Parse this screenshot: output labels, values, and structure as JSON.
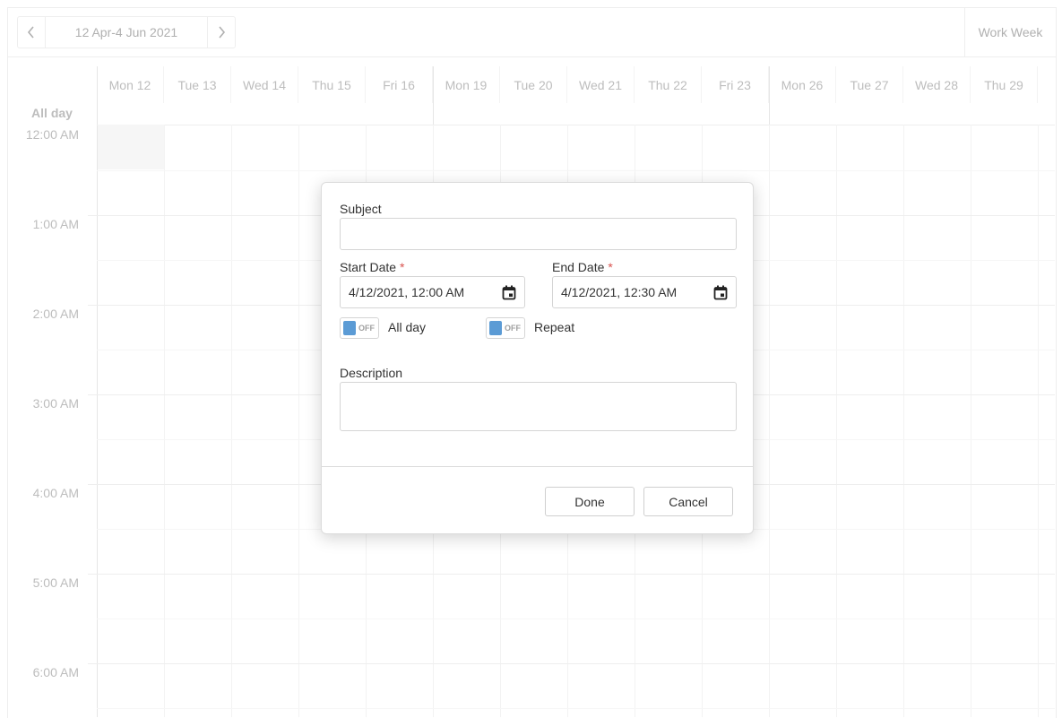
{
  "toolbar": {
    "date_range": "12 Apr-4 Jun 2021",
    "view": "Work Week"
  },
  "grid": {
    "days": [
      "Mon 12",
      "Tue 13",
      "Wed 14",
      "Thu 15",
      "Fri 16",
      "Mon 19",
      "Tue 20",
      "Wed 21",
      "Thu 22",
      "Fri 23",
      "Mon 26",
      "Tue 27",
      "Wed 28",
      "Thu 29"
    ],
    "allday_label": "All day",
    "times": [
      "12:00 AM",
      "1:00 AM",
      "2:00 AM",
      "3:00 AM",
      "4:00 AM",
      "5:00 AM",
      "6:00 AM"
    ]
  },
  "popup": {
    "subject_label": "Subject",
    "subject_value": "",
    "start_label": "Start Date",
    "start_value": "4/12/2021, 12:00 AM",
    "end_label": "End Date",
    "end_value": "4/12/2021, 12:30 AM",
    "required_mark": "*",
    "allday_switch": {
      "state": "OFF",
      "label": "All day"
    },
    "repeat_switch": {
      "state": "OFF",
      "label": "Repeat"
    },
    "description_label": "Description",
    "description_value": "",
    "done_label": "Done",
    "cancel_label": "Cancel"
  },
  "colors": {
    "switch_knob": "#5b9bd5",
    "required": "#d9534f"
  },
  "icons": {
    "prev": "chevron-left-icon",
    "next": "chevron-right-icon",
    "calendar": "calendar-icon"
  }
}
